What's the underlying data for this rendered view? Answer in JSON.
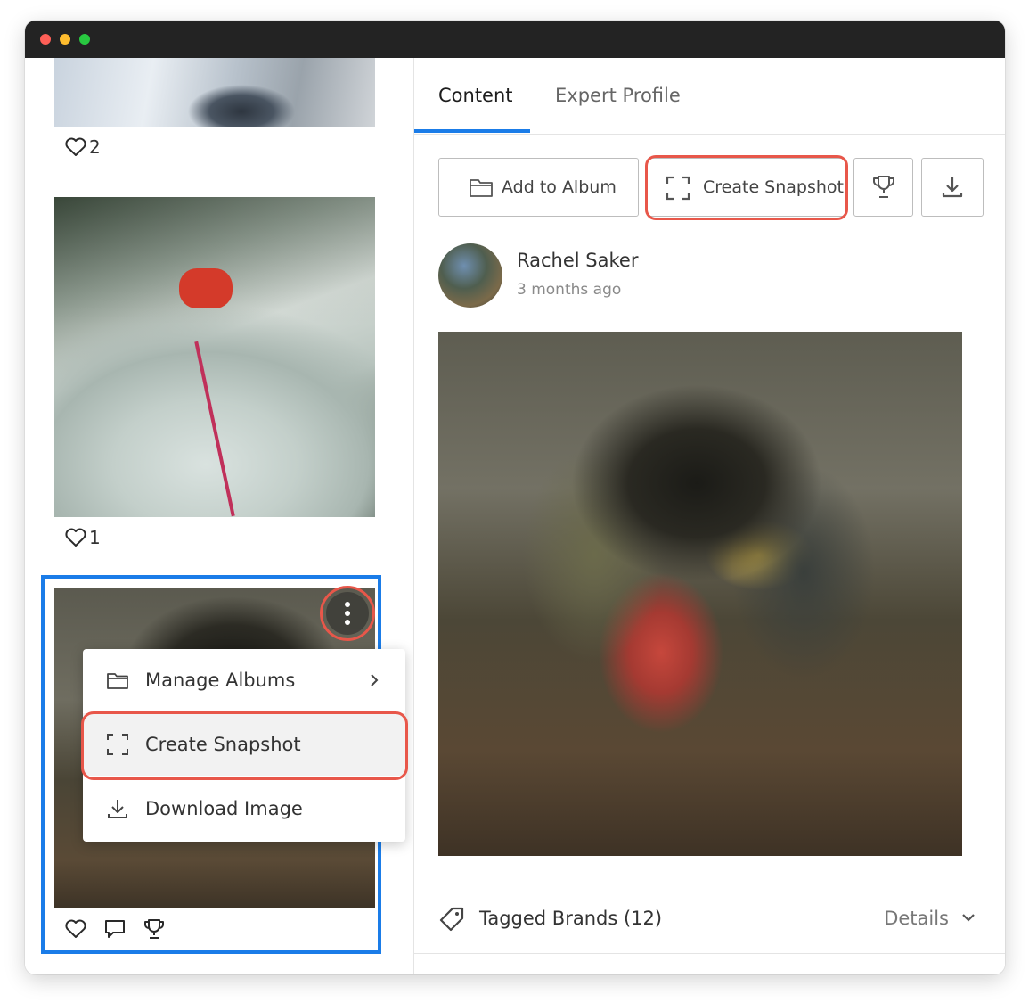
{
  "window": {
    "controls": [
      "close",
      "minimize",
      "maximize"
    ]
  },
  "feed": {
    "posts": [
      {
        "likes": "2"
      },
      {
        "likes": "1"
      }
    ],
    "context_menu": {
      "items": [
        {
          "label": "Manage Albums",
          "icon": "folder-icon"
        },
        {
          "label": "Create Snapshot",
          "icon": "snapshot-icon"
        },
        {
          "label": "Download Image",
          "icon": "download-icon"
        }
      ]
    }
  },
  "detail": {
    "tabs": [
      {
        "label": "Content",
        "active": true
      },
      {
        "label": "Expert Profile",
        "active": false
      }
    ],
    "actions": {
      "add_to_album": "Add to Album",
      "create_snapshot": "Create Snapshot"
    },
    "author": {
      "name": "Rachel Saker",
      "time": "3 months ago"
    },
    "tagged_brands": "Tagged Brands (12)",
    "details_label": "Details"
  },
  "colors": {
    "accent": "#1a7ce8",
    "highlight_ring": "#e8574a"
  }
}
